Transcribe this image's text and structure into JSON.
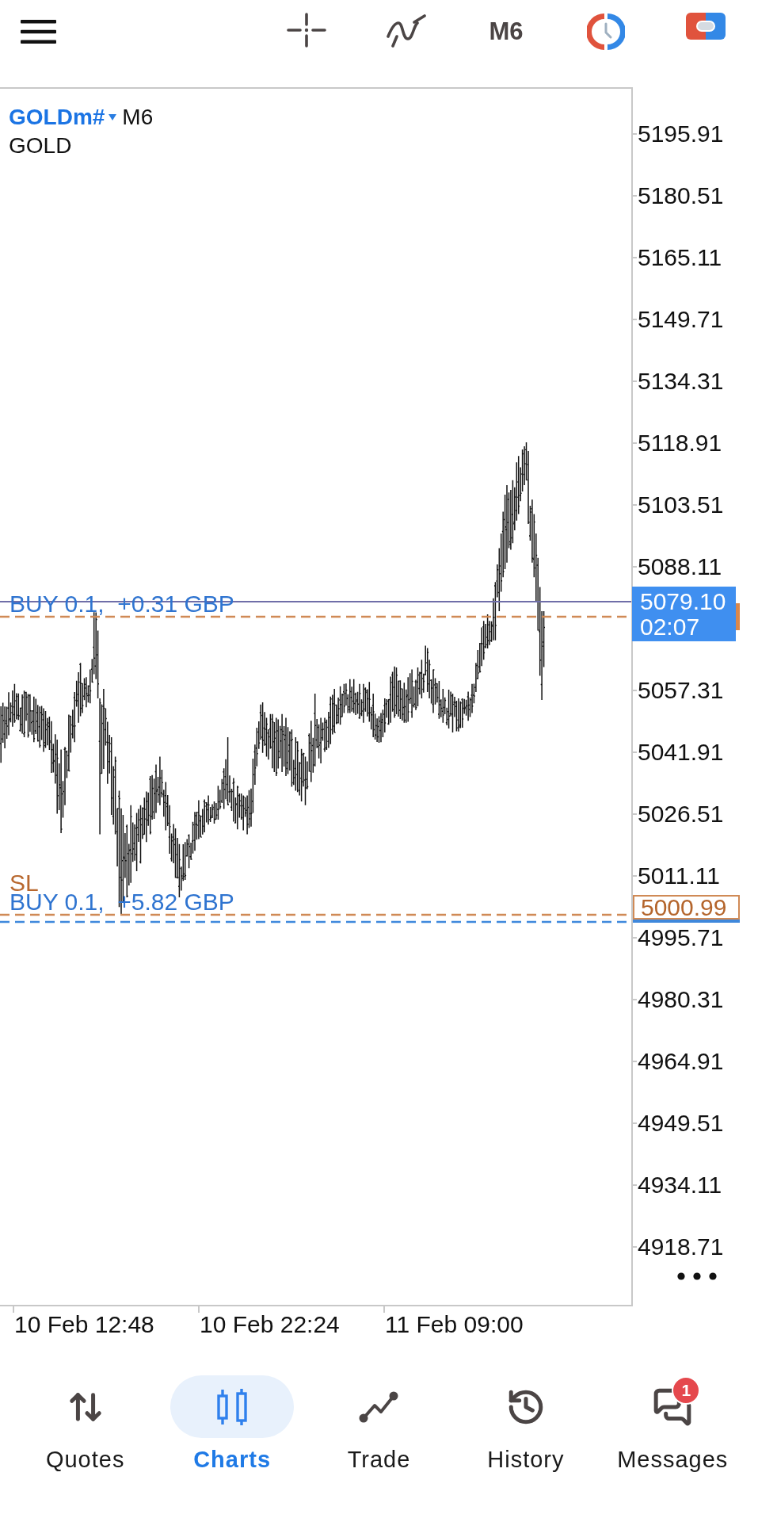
{
  "toolbar": {
    "timeframe": "M6"
  },
  "chart": {
    "symbol": "GOLDm#",
    "timeframe": "M6",
    "description": "GOLD",
    "price_axis": [
      "5195.91",
      "5180.51",
      "5165.11",
      "5149.71",
      "5134.31",
      "5118.91",
      "5103.51",
      "5088.11",
      "5057.31",
      "5041.91",
      "5026.51",
      "5011.11",
      "4995.71",
      "4980.31",
      "4964.91",
      "4949.51",
      "4934.11",
      "4918.71"
    ],
    "time_axis": [
      "10 Feb 12:48",
      "10 Feb 22:24",
      "11 Feb 09:00"
    ],
    "current_price": {
      "price": "5079.10",
      "countdown": "02:07"
    },
    "levels": [
      {
        "kind": "position",
        "label": "BUY 0.1,  +0.31 GBP"
      },
      {
        "kind": "stop_loss",
        "label": "SL",
        "price": "5000.99"
      },
      {
        "kind": "position",
        "label": "BUY 0.1,  +5.82 GBP"
      }
    ]
  },
  "tabs": [
    {
      "label": "Quotes",
      "selected": false
    },
    {
      "label": "Charts",
      "selected": true
    },
    {
      "label": "Trade",
      "selected": false
    },
    {
      "label": "History",
      "selected": false
    },
    {
      "label": "Messages",
      "selected": false,
      "badge": "1"
    }
  ]
}
